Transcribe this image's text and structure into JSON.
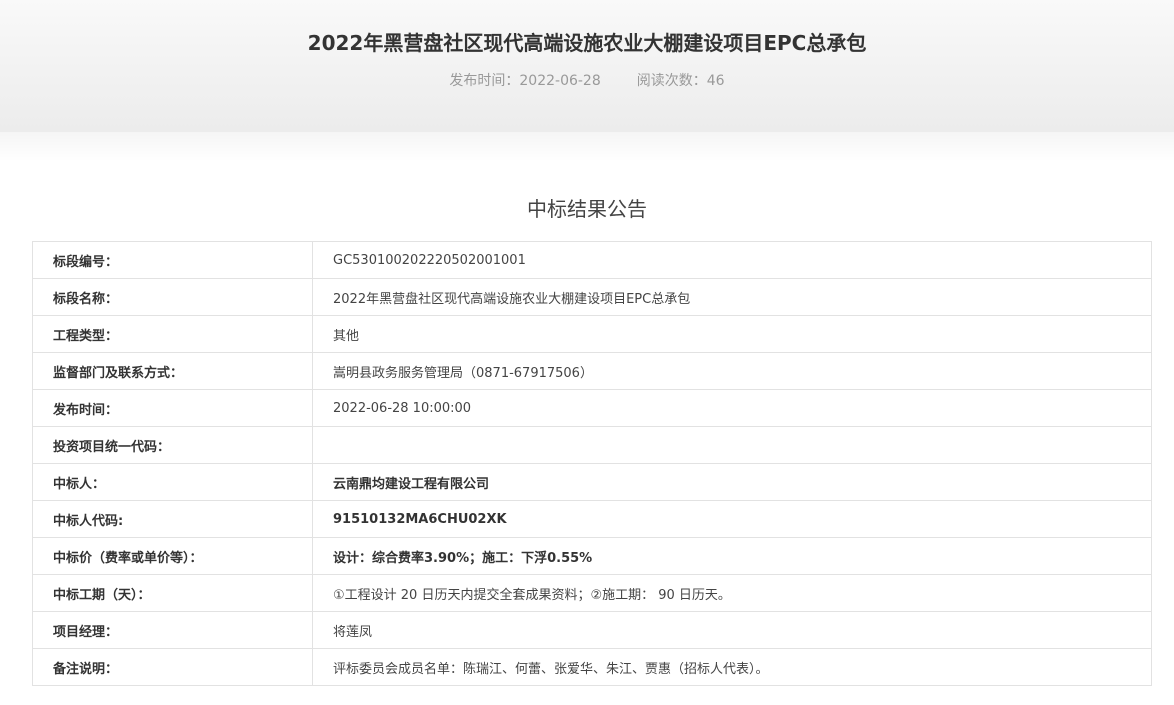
{
  "header": {
    "title": "2022年黑营盘社区现代高端设施农业大棚建设项目EPC总承包",
    "publish_time": "发布时间：2022-06-28",
    "read_count": "阅读次数：46"
  },
  "section_title": "中标结果公告",
  "rows": [
    {
      "label": "标段编号：",
      "value": "GC5301002022205020010​01",
      "bold": false
    },
    {
      "label": "标段名称：",
      "value": "2022年黑营盘社区现代高端设施农业大棚建设项目EPC总承包",
      "bold": false
    },
    {
      "label": "工程类型：",
      "value": "其他",
      "bold": false
    },
    {
      "label": "监督部门及联系方式：",
      "value": "嵩明县政务服务管理局（0871-67917506）",
      "bold": false
    },
    {
      "label": "发布时间：",
      "value": "2022-06-28 10:00:00",
      "bold": false
    },
    {
      "label": "投资项目统一代码：",
      "value": "",
      "bold": false
    },
    {
      "label": "中标人：",
      "value": "云南鼎均建设工程有限公司",
      "bold": true
    },
    {
      "label": "中标人代码:",
      "value": "91510132MA6CHU02XK",
      "bold": true
    },
    {
      "label": "中标价（费率或单价等）：",
      "value": "设计：综合费率3.90%；施工：下浮0.55%",
      "bold": true
    },
    {
      "label": "中标工期（天）：",
      "value": "①工程设计 20 日历天内提交全套成果资料；②施工期： 90 日历天。",
      "bold": false
    },
    {
      "label": "项目经理：",
      "value": "将莲凤",
      "bold": false
    },
    {
      "label": "备注说明：",
      "value": "评标委员会成员名单：陈瑞江、何蕾、张爱华、朱江、贾惠（招标人代表）。",
      "bold": false
    }
  ]
}
